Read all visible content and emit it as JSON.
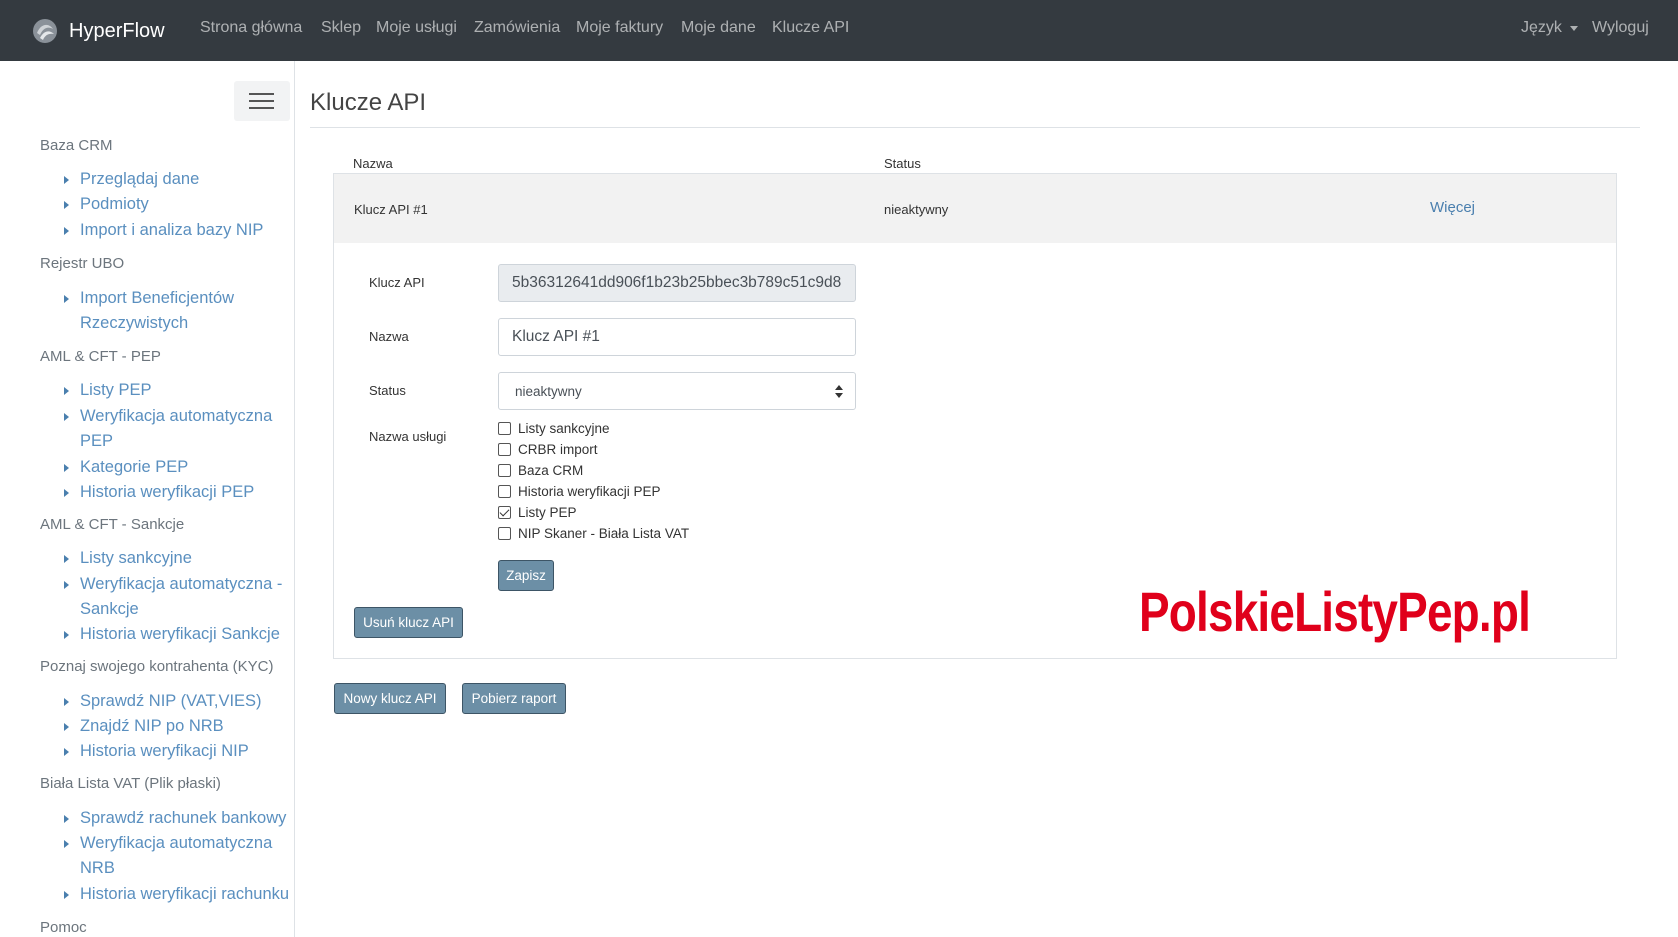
{
  "navbar": {
    "brand": "HyperFlow",
    "items": [
      "Strona główna",
      "Sklep",
      "Moje usługi",
      "Zamówienia",
      "Moje faktury",
      "Moje dane",
      "Klucze API"
    ],
    "language": "Język",
    "logout": "Wyloguj"
  },
  "sidebar": {
    "sections": [
      {
        "title": "Baza CRM",
        "links": [
          "Przeglądaj dane",
          "Podmioty",
          "Import i analiza bazy NIP"
        ]
      },
      {
        "title": "Rejestr UBO",
        "links": [
          "Import Beneficjentów Rzeczywistych"
        ]
      },
      {
        "title": "AML & CFT - PEP",
        "links": [
          "Listy PEP",
          "Weryfikacja automatyczna PEP",
          "Kategorie PEP",
          "Historia weryfikacji PEP"
        ]
      },
      {
        "title": "AML & CFT - Sankcje",
        "links": [
          "Listy sankcyjne",
          "Weryfikacja automatyczna - Sankcje",
          "Historia weryfikacji Sankcje"
        ]
      },
      {
        "title": "Poznaj swojego kontrahenta (KYC)",
        "links": [
          "Sprawdź NIP (VAT,VIES)",
          "Znajdź NIP po NRB",
          "Historia weryfikacji NIP"
        ]
      },
      {
        "title": "Biała Lista VAT (Plik płaski)",
        "links": [
          "Sprawdź rachunek bankowy",
          "Weryfikacja automatyczna NRB",
          "Historia weryfikacji rachunku"
        ]
      },
      {
        "title": "Pomoc",
        "links": []
      }
    ]
  },
  "main": {
    "title": "Klucze API",
    "table": {
      "headers": {
        "name": "Nazwa",
        "status": "Status"
      },
      "row": {
        "name": "Klucz API #1",
        "status": "nieaktywny",
        "more": "Więcej"
      }
    },
    "form": {
      "api_key_label": "Klucz API",
      "api_key_value": "5b36312641dd906f1b23b25bbec3b789c51c9d8",
      "name_label": "Nazwa",
      "name_value": "Klucz API #1",
      "status_label": "Status",
      "status_value": "nieaktywny",
      "services_label": "Nazwa usługi",
      "services": [
        {
          "label": "Listy sankcyjne",
          "checked": false
        },
        {
          "label": "CRBR import",
          "checked": false
        },
        {
          "label": "Baza CRM",
          "checked": false
        },
        {
          "label": "Historia weryfikacji PEP",
          "checked": false
        },
        {
          "label": "Listy PEP",
          "checked": true
        },
        {
          "label": "NIP Skaner - Biała Lista VAT",
          "checked": false
        }
      ],
      "save": "Zapisz",
      "delete": "Usuń klucz API"
    },
    "new_key": "Nowy klucz API",
    "download_report": "Pobierz raport"
  },
  "watermark": "PolskieListyPep.pl",
  "colors": {
    "navbar": "#343a40",
    "link": "#5a8fbf",
    "button": "#6c8fa6",
    "watermark": "#e0001b"
  }
}
